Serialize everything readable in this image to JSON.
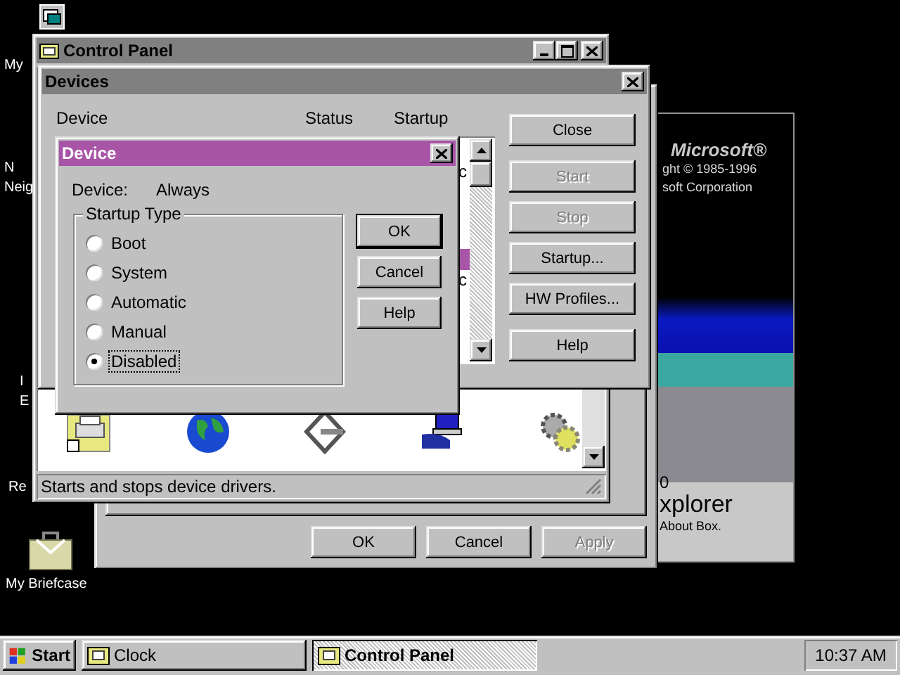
{
  "desktop_icons": [
    {
      "kind": "window"
    },
    {
      "kind": "hidden",
      "lines": [
        "My"
      ]
    },
    {
      "kind": "hidden",
      "lines": [
        "N",
        "Neig"
      ]
    },
    {
      "kind": "hidden",
      "lines": [
        "I",
        "E"
      ]
    },
    {
      "kind": "hidden",
      "lines": [
        "Re"
      ]
    },
    {
      "kind": "briefcase",
      "lines": [
        "My Briefcase"
      ]
    }
  ],
  "about_box": {
    "brand": "Microsoft®",
    "top_lines": [
      "ght © 1985-1996",
      "soft Corporation"
    ],
    "version": "0",
    "product": "xplorer",
    "caption": "About Box."
  },
  "properties_window": {
    "buttons": [
      {
        "label": "OK",
        "disabled": false
      },
      {
        "label": "Cancel",
        "disabled": false
      },
      {
        "label": "Apply",
        "disabled": true
      }
    ]
  },
  "control_panel": {
    "title": "Control Panel",
    "icons": [
      {
        "kind": "printer"
      },
      {
        "kind": "globe"
      },
      {
        "kind": "scsi"
      },
      {
        "kind": "server"
      },
      {
        "kind": "gears"
      }
    ],
    "status_text": "Starts and stops device drivers."
  },
  "devices": {
    "title": "Devices",
    "columns": [
      "Device",
      "Status",
      "Startup"
    ],
    "rows": [
      {
        "selected": false
      },
      {
        "selected": false,
        "startup": "c"
      },
      {
        "selected": false
      },
      {
        "selected": false
      },
      {
        "selected": false
      },
      {
        "selected": true
      },
      {
        "selected": false,
        "startup": "c"
      },
      {
        "selected": false
      },
      {
        "selected": false
      },
      {
        "selected": false
      }
    ],
    "buttons": [
      {
        "label": "Close",
        "disabled": false
      },
      {
        "label": "Start",
        "disabled": true
      },
      {
        "label": "Stop",
        "disabled": true
      },
      {
        "label": "Startup...",
        "disabled": false
      },
      {
        "label": "HW Profiles...",
        "disabled": false
      },
      {
        "label": "Help",
        "disabled": false
      }
    ]
  },
  "device_dialog": {
    "title": "Device",
    "device_label": "Device:",
    "device_value": "Always",
    "group_title": "Startup Type",
    "options": [
      {
        "label": "Boot",
        "selected": false
      },
      {
        "label": "System",
        "selected": false
      },
      {
        "label": "Automatic",
        "selected": false
      },
      {
        "label": "Manual",
        "selected": false
      },
      {
        "label": "Disabled",
        "selected": true
      }
    ],
    "buttons": [
      {
        "label": "OK",
        "default": true
      },
      {
        "label": "Cancel",
        "default": false
      },
      {
        "label": "Help",
        "default": false
      }
    ]
  },
  "taskbar": {
    "start": "Start",
    "tasks": [
      {
        "label": "Clock",
        "selected": false
      },
      {
        "label": "Control Panel",
        "selected": true
      }
    ],
    "clock": "10:37 AM"
  }
}
